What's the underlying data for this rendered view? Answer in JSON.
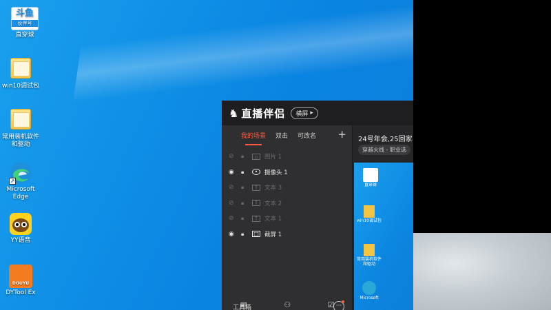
{
  "desktop": {
    "icons": [
      {
        "label": "斗鱼",
        "sublabel": "伙伴号",
        "caption": "直穿球",
        "icon": "douyu-logo-icon"
      },
      {
        "label": "win10调试包",
        "icon": "folder-icon"
      },
      {
        "label": "常用装机软件和驱动",
        "icon": "folder-icon"
      },
      {
        "label": "Microsoft Edge",
        "icon": "edge-icon"
      },
      {
        "label": "YY语音",
        "icon": "yy-voice-icon"
      },
      {
        "label": "DYTool Ex",
        "icon": "dytool-icon",
        "badge": "DOUYU"
      }
    ]
  },
  "app": {
    "title": "直播伴侣",
    "mode_label": "横屏",
    "tabs": [
      "我的场景",
      "双击",
      "可改名"
    ],
    "add_label": "+",
    "scenes": [
      {
        "name": "图片 1",
        "visible": false,
        "type": "image"
      },
      {
        "name": "摄像头 1",
        "visible": true,
        "type": "camera"
      },
      {
        "name": "文本 3",
        "visible": false,
        "type": "text"
      },
      {
        "name": "文本 2",
        "visible": false,
        "type": "text"
      },
      {
        "name": "文本 1",
        "visible": false,
        "type": "text"
      },
      {
        "name": "截屏 1",
        "visible": true,
        "type": "screen"
      }
    ],
    "toolbox_label": "工具箱",
    "room_title": "24号年会,25回家",
    "tag_label": "穿越火线 - 职业选",
    "preview_icons": [
      "直穿球",
      "win10调试包",
      "常用装机软件和驱动",
      "Microsoft"
    ]
  },
  "colors": {
    "accent": "#ff5a3c",
    "desktop_blue": "#0f8fe6",
    "panel_dark": "#2b2b2d"
  }
}
